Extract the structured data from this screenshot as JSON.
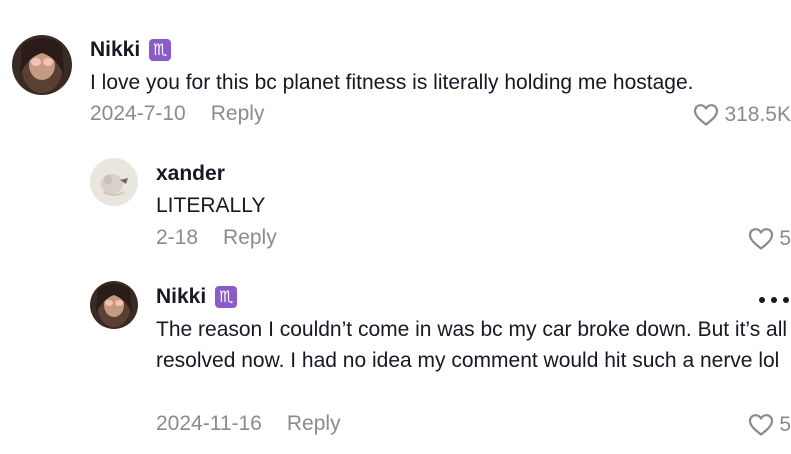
{
  "comments": [
    {
      "username": "Nikki",
      "zodiac": "♏",
      "text": "I love you for this bc planet fitness is literally holding me hostage.",
      "date": "2024-7-10",
      "reply_label": "Reply",
      "likes": "318.5K"
    },
    {
      "username": "xander",
      "text": "LITERALLY",
      "date": "2-18",
      "reply_label": "Reply",
      "likes": "5"
    },
    {
      "username": "Nikki",
      "zodiac": "♏",
      "text": "The reason I couldn’t come in was bc my car broke down. But it’s all resolved now. I had no idea my comment would hit such a nerve lol",
      "date": "2024-11-16",
      "reply_label": "Reply",
      "likes": "5"
    }
  ],
  "icons": {
    "like": "heart-outline-icon",
    "more": "more-options-icon",
    "zodiac": "scorpio-icon"
  },
  "colors": {
    "text": "#161823",
    "secondary": "#8a8b91",
    "zodiac_badge": "#8b5cc8"
  }
}
